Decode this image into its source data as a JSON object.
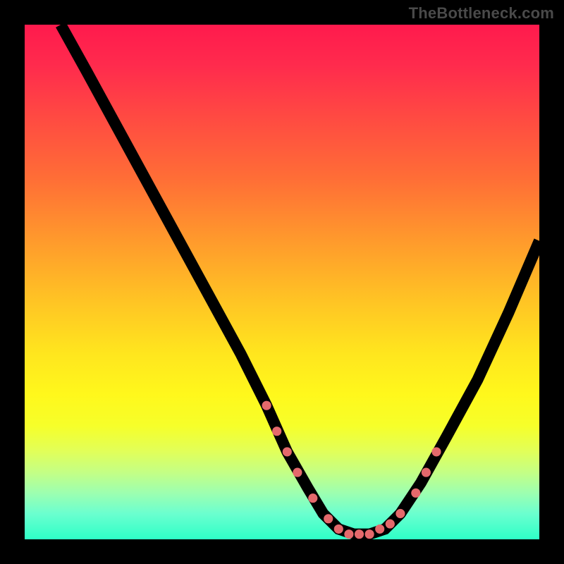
{
  "watermark": "TheBottleneck.com",
  "chart_data": {
    "type": "line",
    "title": "",
    "xlabel": "",
    "ylabel": "",
    "xlim": [
      0,
      100
    ],
    "ylim": [
      0,
      100
    ],
    "grid": false,
    "legend": false,
    "series": [
      {
        "name": "bottleneck-curve",
        "x": [
          7,
          12,
          18,
          24,
          30,
          36,
          42,
          47,
          51,
          55,
          58,
          61,
          64,
          67,
          70,
          73,
          77,
          82,
          88,
          94,
          100
        ],
        "y": [
          100,
          91,
          80,
          69,
          58,
          47,
          36,
          26,
          17,
          10,
          5,
          2,
          1,
          1,
          2,
          5,
          11,
          20,
          31,
          44,
          58
        ]
      }
    ],
    "markers": {
      "name": "highlighted-points",
      "x": [
        47,
        49,
        51,
        53,
        56,
        59,
        61,
        63,
        65,
        67,
        69,
        71,
        73,
        76,
        78,
        80
      ],
      "y": [
        26,
        21,
        17,
        13,
        8,
        4,
        2,
        1,
        1,
        1,
        2,
        3,
        5,
        9,
        13,
        17
      ]
    },
    "gradient_stops": [
      {
        "pct": 0,
        "color": "#ff1a4d"
      },
      {
        "pct": 18,
        "color": "#ff4a42"
      },
      {
        "pct": 42,
        "color": "#ff9a2c"
      },
      {
        "pct": 64,
        "color": "#ffe61e"
      },
      {
        "pct": 83,
        "color": "#e1ff5a"
      },
      {
        "pct": 100,
        "color": "#2effc7"
      }
    ]
  }
}
